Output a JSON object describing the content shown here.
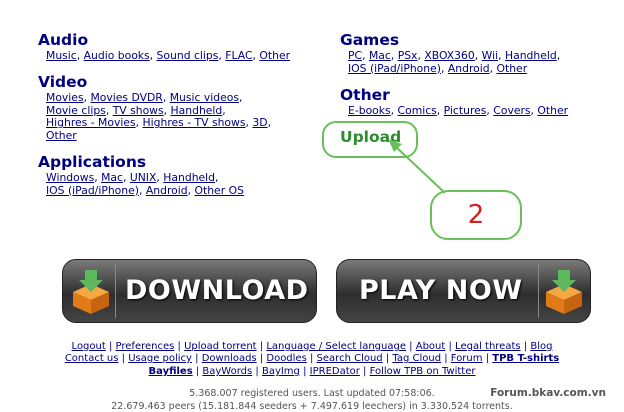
{
  "categories": {
    "audio": {
      "title": "Audio",
      "links": [
        "Music",
        "Audio books",
        "Sound clips",
        "FLAC",
        "Other"
      ]
    },
    "video": {
      "title": "Video",
      "line1": [
        "Movies",
        "Movies DVDR",
        "Music videos"
      ],
      "line2": [
        "Movie clips",
        "TV shows",
        "Handheld"
      ],
      "line3": [
        "Highres - Movies",
        "Highres - TV shows",
        "3D"
      ],
      "line4": [
        "Other"
      ]
    },
    "applications": {
      "title": "Applications",
      "line1": [
        "Windows",
        "Mac",
        "UNIX",
        "Handheld"
      ],
      "line2": [
        "IOS (iPad/iPhone)",
        "Android",
        "Other OS"
      ]
    },
    "games": {
      "title": "Games",
      "line1": [
        "PC",
        "Mac",
        "PSx",
        "XBOX360",
        "Wii",
        "Handheld"
      ],
      "line2": [
        "IOS (iPad/iPhone)",
        "Android",
        "Other"
      ]
    },
    "other": {
      "title": "Other",
      "links": [
        "E-books",
        "Comics",
        "Pictures",
        "Covers",
        "Other"
      ]
    },
    "upload": {
      "title": "Upload"
    }
  },
  "annotation": {
    "number": "2"
  },
  "buttons": {
    "download": "DOWNLOAD",
    "play_now": "PLAY NOW"
  },
  "footer": {
    "line1": [
      "Logout",
      "Preferences",
      "Upload torrent",
      "Language / Select language",
      "About",
      "Legal threats",
      "Blog"
    ],
    "line2": [
      "Contact us",
      "Usage policy",
      "Downloads",
      "Doodles",
      "Search Cloud",
      "Tag Cloud",
      "Forum",
      "TPB T-shirts"
    ],
    "line3": [
      "Bayfiles",
      "BayWords",
      "BayImg",
      "IPREDator",
      "Follow TPB on Twitter"
    ]
  },
  "stats": {
    "line1": "5.368.007 registered users. Last updated 07:58:06.",
    "line2": "22.679.463 peers (15.181.844 seeders + 7.497.619 leechers) in 3.330.524 torrents."
  },
  "watermark": "Forum.bkav.com.vn",
  "colors": {
    "link": "#000080",
    "upload_green": "#2e8b2e",
    "highlight_green": "#6abf5b",
    "annotation_red": "#d02020"
  },
  "icons": [
    "download-box-icon",
    "download-box-icon"
  ]
}
